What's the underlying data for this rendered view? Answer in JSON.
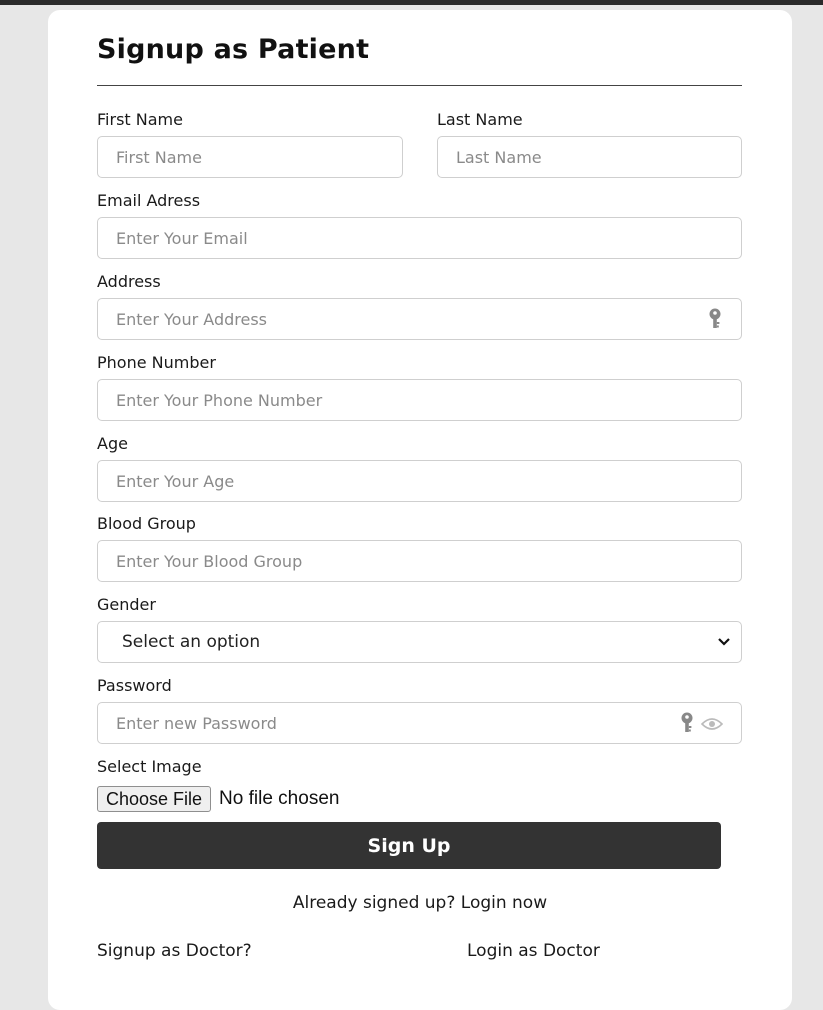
{
  "form": {
    "title": "Signup as Patient",
    "first_name": {
      "label": "First Name",
      "placeholder": "First Name"
    },
    "last_name": {
      "label": "Last Name",
      "placeholder": "Last Name"
    },
    "email": {
      "label": "Email Adress",
      "placeholder": "Enter Your Email"
    },
    "address": {
      "label": "Address",
      "placeholder": "Enter Your Address",
      "icon": "key-icon"
    },
    "phone": {
      "label": "Phone Number",
      "placeholder": "Enter Your Phone Number"
    },
    "age": {
      "label": "Age",
      "placeholder": "Enter Your Age"
    },
    "blood_group": {
      "label": "Blood Group",
      "placeholder": "Enter Your Blood Group"
    },
    "gender": {
      "label": "Gender",
      "selected": "Select an option",
      "icon": "chevron-down-icon"
    },
    "password": {
      "label": "Password",
      "placeholder": "Enter new Password",
      "icons": [
        "key-icon",
        "eye-icon"
      ]
    },
    "image": {
      "label": "Select Image",
      "button": "Choose File",
      "status": "No file chosen"
    },
    "submit": "Sign Up",
    "already_text": "Already signed up?",
    "login_link": "Login now",
    "signup_doctor": "Signup as Doctor?",
    "login_doctor": "Login as Doctor"
  },
  "colors": {
    "page_background": "#e7e7e7",
    "card_background": "#ffffff",
    "button_background": "#333333",
    "button_text": "#ffffff",
    "border": "#cfcfcf",
    "placeholder": "#8a8a8a"
  }
}
